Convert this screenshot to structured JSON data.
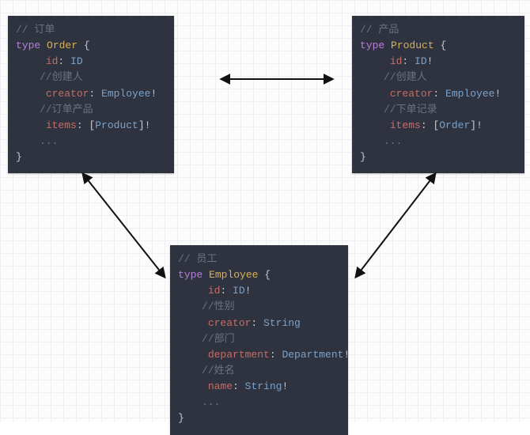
{
  "order": {
    "comment": "// 订单",
    "decl_kw": "type",
    "decl_name": "Order",
    "brace_open": "{",
    "f1": {
      "name": "id",
      "type": "ID"
    },
    "c2": "//创建人",
    "f2": {
      "name": "creator",
      "type": "Employee",
      "bang": "!"
    },
    "c3": "//订单产品",
    "f3": {
      "name": "items",
      "lb": "[",
      "type": "Product",
      "rb": "]",
      "bang": "!"
    },
    "dots": "...",
    "brace_close": "}"
  },
  "product": {
    "comment": "// 产品",
    "decl_kw": "type",
    "decl_name": "Product",
    "brace_open": "{",
    "f1": {
      "name": "id",
      "type": "ID",
      "bang": "!"
    },
    "c2": "//创建人",
    "f2": {
      "name": "creator",
      "type": "Employee",
      "bang": "!"
    },
    "c3": "//下单记录",
    "f3": {
      "name": "items",
      "lb": "[",
      "type": "Order",
      "rb": "]",
      "bang": "!"
    },
    "dots": "...",
    "brace_close": "}"
  },
  "employee": {
    "comment": "// 员工",
    "decl_kw": "type",
    "decl_name": "Employee",
    "brace_open": "{",
    "f1": {
      "name": "id",
      "type": "ID",
      "bang": "!"
    },
    "c2": "//性别",
    "f2": {
      "name": "creator",
      "type": "String"
    },
    "c3": "//部门",
    "f3": {
      "name": "department",
      "type": "Department",
      "bang": "!"
    },
    "c4": "//姓名",
    "f4": {
      "name": "name",
      "type": "String",
      "bang": "!"
    },
    "dots": "...",
    "brace_close": "}"
  }
}
